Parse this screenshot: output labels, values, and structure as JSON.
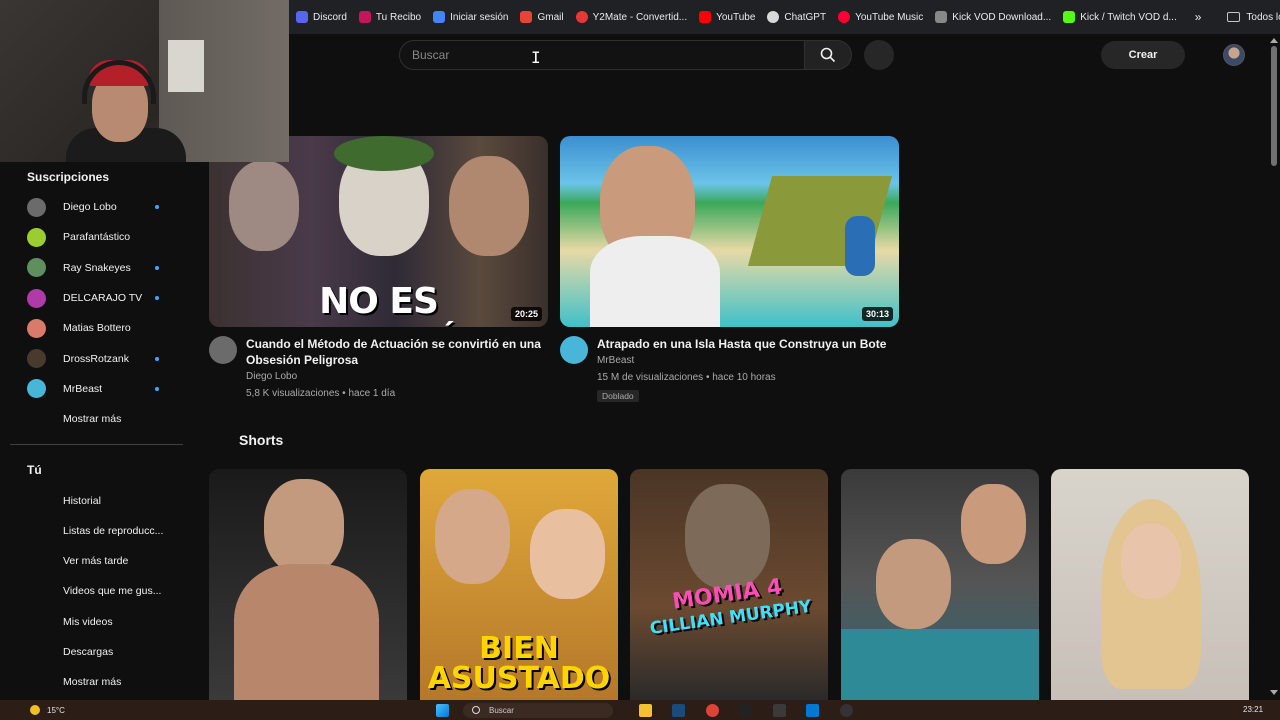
{
  "bookmarks": {
    "items": [
      {
        "label": "Discord",
        "icon": "discord-icon",
        "color": "#5865f2"
      },
      {
        "label": "Tu Recibo",
        "icon": "recibo-icon",
        "color": "#c2185b"
      },
      {
        "label": "Iniciar sesión",
        "icon": "login-icon",
        "color": "#4285f4"
      },
      {
        "label": "Gmail",
        "icon": "gmail-icon",
        "color": "#ea4335"
      },
      {
        "label": "Y2Mate - Convertid...",
        "icon": "y2mate-icon",
        "color": "#e53935"
      },
      {
        "label": "YouTube",
        "icon": "youtube-icon",
        "color": "#ff0000"
      },
      {
        "label": "ChatGPT",
        "icon": "chatgpt-icon",
        "color": "#d9d9d9"
      },
      {
        "label": "YouTube Music",
        "icon": "youtube-music-icon",
        "color": "#ff0033"
      },
      {
        "label": "Kick VOD Download...",
        "icon": "kick-vod-icon",
        "color": "#888888"
      },
      {
        "label": "Kick / Twitch VOD d...",
        "icon": "kick-icon",
        "color": "#53fc18"
      }
    ],
    "more": "»",
    "all_bookmarks": "Todos los marcadores"
  },
  "masthead": {
    "search_placeholder": "Buscar",
    "create_label": "Crear"
  },
  "sidebar": {
    "subscriptions_title": "Suscripciones",
    "subscriptions": [
      {
        "name": "Diego Lobo",
        "new": true,
        "color": "#6b6b6b"
      },
      {
        "name": "Parafantástico",
        "new": false,
        "color": "#9acd32"
      },
      {
        "name": "Ray Snakeyes",
        "new": true,
        "color": "#5f8f5f"
      },
      {
        "name": "DELCARAJO TV",
        "new": true,
        "color": "#b03aa8"
      },
      {
        "name": "Matias Bottero",
        "new": false,
        "color": "#d97b6a"
      },
      {
        "name": "DrossRotzank",
        "new": true,
        "color": "#4a3a2e"
      },
      {
        "name": "MrBeast",
        "new": true,
        "color": "#49b6d9"
      }
    ],
    "show_more": "Mostrar más",
    "you_title": "Tú",
    "you_items": [
      "Historial",
      "Listas de reproducc...",
      "Ver más tarde",
      "Videos que me gus...",
      "Mis videos",
      "Descargas",
      "Mostrar más"
    ]
  },
  "videos": [
    {
      "title_line1": "Cuando el Método de Actuación se convirtió en una",
      "title_line2": "Obsesión Peligrosa",
      "channel": "Diego Lobo",
      "stats": "5,8 K visualizaciones • hace 1 día",
      "duration": "20:25",
      "thumb_text": "NO ES ACTUACIÓN"
    },
    {
      "title_line1": "Atrapado en una Isla Hasta que Construya un Bote",
      "channel": "MrBeast",
      "stats": "15 M de visualizaciones • hace 10 horas",
      "duration": "30:13",
      "badge": "Doblado"
    }
  ],
  "shorts": {
    "title": "Shorts",
    "items": [
      {
        "text": ""
      },
      {
        "text_line1": "BIEN",
        "text_line2": "ASUSTADO"
      },
      {
        "text_line1": "MOMIA 4",
        "text_line2": "CILLIAN MURPHY"
      },
      {
        "text": ""
      },
      {
        "text": ""
      }
    ]
  },
  "taskbar": {
    "weather": "15°C",
    "search": "Buscar",
    "time": "23:21"
  },
  "colors": {
    "background": "#0f0f0f",
    "new_dot": "#3ea6ff",
    "taskbar": "#2c1d17"
  }
}
